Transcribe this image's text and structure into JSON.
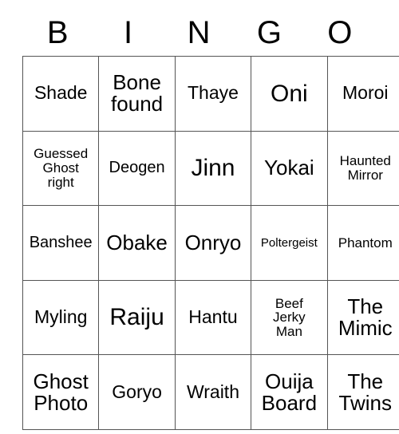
{
  "card": {
    "header_letters": [
      "B",
      "I",
      "N",
      "G",
      "O"
    ],
    "rows": [
      [
        {
          "text": "Shade",
          "size": "md"
        },
        {
          "text": "Bone\nfound",
          "size": "lg"
        },
        {
          "text": "Thaye",
          "size": "md"
        },
        {
          "text": "Oni",
          "size": "xl"
        },
        {
          "text": "Moroi",
          "size": "md"
        }
      ],
      [
        {
          "text": "Guessed\nGhost\nright",
          "size": "xs"
        },
        {
          "text": "Deogen",
          "size": "sm"
        },
        {
          "text": "Jinn",
          "size": "xl"
        },
        {
          "text": "Yokai",
          "size": "lg"
        },
        {
          "text": "Haunted\nMirror",
          "size": "xs"
        }
      ],
      [
        {
          "text": "Banshee",
          "size": "sm"
        },
        {
          "text": "Obake",
          "size": "lg"
        },
        {
          "text": "Onryo",
          "size": "lg"
        },
        {
          "text": "Poltergeist",
          "size": "xxs"
        },
        {
          "text": "Phantom",
          "size": "xs"
        }
      ],
      [
        {
          "text": "Myling",
          "size": "md"
        },
        {
          "text": "Raiju",
          "size": "xl"
        },
        {
          "text": "Hantu",
          "size": "md"
        },
        {
          "text": "Beef\nJerky\nMan",
          "size": "xs"
        },
        {
          "text": "The\nMimic",
          "size": "lg"
        }
      ],
      [
        {
          "text": "Ghost\nPhoto",
          "size": "lg"
        },
        {
          "text": "Goryo",
          "size": "md"
        },
        {
          "text": "Wraith",
          "size": "md"
        },
        {
          "text": "Ouija\nBoard",
          "size": "lg"
        },
        {
          "text": "The\nTwins",
          "size": "lg"
        }
      ]
    ],
    "colors": {
      "background": "#ffffff",
      "text": "#000000",
      "border": "#555555"
    }
  }
}
